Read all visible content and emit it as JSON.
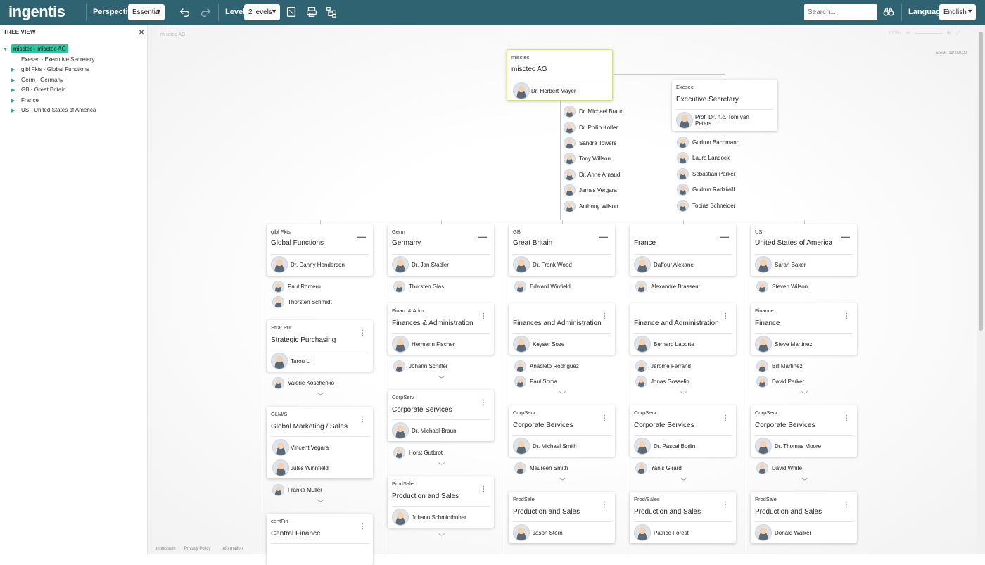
{
  "toolbar": {
    "logo": "ingentis",
    "perspective_label": "Perspective:",
    "perspective_value": "Essential",
    "level_label": "Level:",
    "level_value": "2 levels",
    "search_placeholder": "Search...",
    "language_label": "Language:",
    "language_value": "English"
  },
  "sidebar": {
    "title": "TREE VIEW",
    "items": [
      {
        "label": "misctec - misctec AG",
        "selected": true,
        "expanded": true
      },
      {
        "label": "Exesec - Executive Secretary",
        "selected": false
      },
      {
        "label": "glbl Fkts - Global Functions",
        "selected": false
      },
      {
        "label": "Germ - Germany",
        "selected": false
      },
      {
        "label": "GB - Great Britain",
        "selected": false
      },
      {
        "label": "France",
        "selected": false
      },
      {
        "label": "US - United States of America",
        "selected": false
      }
    ]
  },
  "canvas": {
    "breadcrumb": "misctec AG",
    "zoom": "100%",
    "stock": "Stock: 11/4/2022"
  },
  "footer": {
    "impressum": "Impressum",
    "privacy": "Privacy Policy",
    "information": "Information"
  },
  "root": {
    "code": "misctec",
    "title": "misctec AG",
    "head": "Dr. Herbert Mayer",
    "staff": [
      "Dr. Michael Braun",
      "Dr. Philip Kotler",
      "Sandra Towers",
      "Tony Willson",
      "Dr. Anne Arnaud",
      "James Vergara",
      "Anthony Wilson"
    ]
  },
  "exesec": {
    "code": "Exesec",
    "title": "Executive Secretary",
    "head": "Prof. Dr. h.c. Tom van Peters",
    "staff": [
      "Gudrun Bachmann",
      "Laura Landock",
      "Sebastian Parker",
      "Gudrun Radziwill",
      "Tobias Schneider"
    ]
  },
  "columns": [
    {
      "code": "glbl Fkts",
      "title": "Global Functions",
      "head": "Dr. Danny Henderson",
      "staff": [
        "Paul Romero",
        "Thorsten Schmidt"
      ],
      "units": [
        {
          "code": "Strat Pur",
          "title": "Strategic Purchasing",
          "head": "Tarou Li",
          "staff": [
            "Valerie Koschenko"
          ]
        },
        {
          "code": "GLM/S",
          "title": "Global Marketing / Sales",
          "heads": [
            "Vincent Vegara",
            "Jules Winnfield"
          ],
          "staff": [
            "Franka Müller"
          ]
        },
        {
          "code": "centFin",
          "title": "Central Finance"
        }
      ]
    },
    {
      "code": "Germ",
      "title": "Germany",
      "head": "Dr. Jan Stadler",
      "staff": [
        "Thorsten Glas"
      ],
      "units": [
        {
          "code": "Finan. & Adm.",
          "title": "Finances & Administration",
          "head": "Hermann Fischer",
          "staff": [
            "Johann Schiffer"
          ]
        },
        {
          "code": "CorpServ",
          "title": "Corporate Services",
          "head": "Dr. Michael Braun",
          "staff": [
            "Horst Gutbrot"
          ]
        },
        {
          "code": "ProdSale",
          "title": "Production and Sales",
          "head": "Johann Schmidthuber"
        }
      ]
    },
    {
      "code": "GB",
      "title": "Great Britain",
      "head": "Dr. Frank Wood",
      "staff": [
        "Edward Winfield"
      ],
      "units": [
        {
          "code": "",
          "title": "Finances and Administration",
          "head": "Keyser Soze",
          "staff": [
            "Anacleto Rodriguez",
            "Paul Soma"
          ]
        },
        {
          "code": "CorpServ",
          "title": "Corporate Services",
          "head": "Dr. Michael Smith",
          "staff": [
            "Maureen Smith"
          ]
        },
        {
          "code": "ProdSale",
          "title": "Production and Sales",
          "head": "Jason Stern"
        }
      ]
    },
    {
      "code": "",
      "title": "France",
      "head": "Daffour Alexane",
      "staff": [
        "Alexandre Brasseur"
      ],
      "units": [
        {
          "code": "",
          "title": "Finance and Administration",
          "head": "Bernard Laporte",
          "staff": [
            "Jérôme Ferrand",
            "Jonas Gosselin"
          ]
        },
        {
          "code": "CorpServ",
          "title": "Corporate Services",
          "head": "Dr. Pascal Bodin",
          "staff": [
            "Yanis Girard"
          ]
        },
        {
          "code": "Prod/Sales",
          "title": "Production and Sales",
          "head": "Patrice Forest"
        }
      ]
    },
    {
      "code": "US",
      "title": "United States of America",
      "head": "Sarah Baker",
      "staff": [
        "Steven Wilson"
      ],
      "units": [
        {
          "code": "Finance",
          "title": "Finance",
          "head": "Steve Martinez",
          "staff": [
            "Bill Martinez",
            "David Parker"
          ]
        },
        {
          "code": "CorpServ",
          "title": "Corporate Services",
          "head": "Dr. Thomas Moore",
          "staff": [
            "David White"
          ]
        },
        {
          "code": "ProdSale",
          "title": "Production and Sales",
          "head": "Donald Walker"
        }
      ]
    }
  ]
}
